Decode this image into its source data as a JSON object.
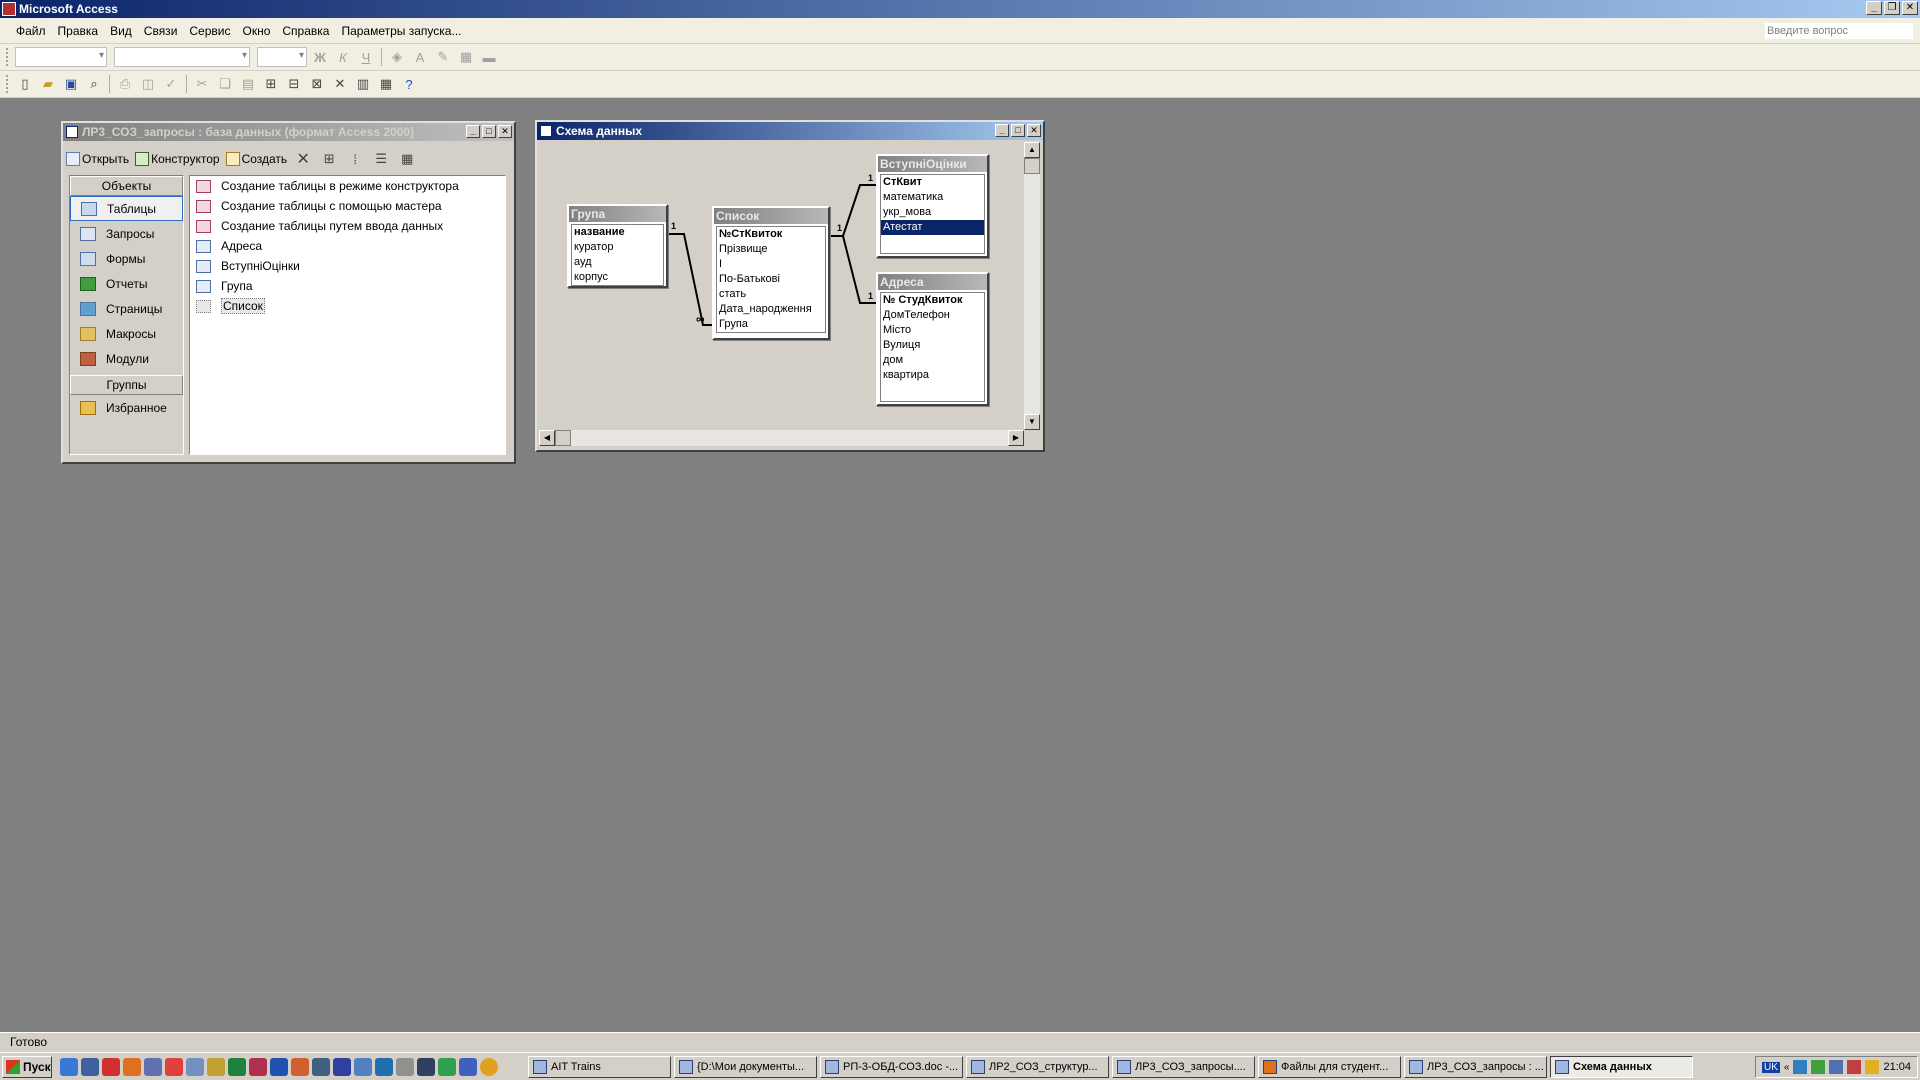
{
  "app": {
    "title": "Microsoft Access"
  },
  "menu": {
    "items": [
      "Файл",
      "Правка",
      "Вид",
      "Связи",
      "Сервис",
      "Окно",
      "Справка",
      "Параметры запуска..."
    ],
    "ask_placeholder": "Введите вопрос"
  },
  "db_window": {
    "title": "ЛР3_СОЗ_запросы : база данных (формат Access 2000)",
    "toolbar": {
      "open": "Открыть",
      "design": "Конструктор",
      "create": "Создать"
    },
    "objects_header": "Объекты",
    "objects": [
      "Таблицы",
      "Запросы",
      "Формы",
      "Отчеты",
      "Страницы",
      "Макросы",
      "Модули"
    ],
    "groups_header": "Группы",
    "groups": [
      "Избранное"
    ],
    "list": [
      "Создание таблицы в режиме конструктора",
      "Создание таблицы с помощью мастера",
      "Создание таблицы путем ввода данных",
      "Адреса",
      "ВступніОцінки",
      "Група",
      "Список"
    ]
  },
  "schema_window": {
    "title": "Схема данных",
    "tables": [
      {
        "name": "Група",
        "fields": [
          "название",
          "куратор",
          "ауд",
          "корпус"
        ]
      },
      {
        "name": "Список",
        "fields": [
          "№СтКвиток",
          "Прізвище",
          "І",
          "По-Батькові",
          "стать",
          "Дата_народження",
          "Група"
        ]
      },
      {
        "name": "ВступніОцінки",
        "fields": [
          "СтКвит",
          "математика",
          "укр_мова",
          "Атестат"
        ]
      },
      {
        "name": "Адреса",
        "fields": [
          "№ СтудКвиток",
          "ДомТелефон",
          "Місто",
          "Вулиця",
          "дом",
          "квартира"
        ]
      }
    ],
    "rel_labels": {
      "one": "1",
      "many": "∞"
    }
  },
  "status": {
    "text": "Готово"
  },
  "taskbar": {
    "start": "Пуск",
    "buttons": [
      "AIT Trains",
      "{D:\\Мои документы...",
      "РП-3-ОБД-СОЗ.doc -...",
      "ЛР2_СОЗ_структур...",
      "ЛР3_СОЗ_запросы....",
      "Файлы для студент...",
      "ЛР3_СОЗ_запросы : ...",
      "Схема данных"
    ],
    "lang": "UK",
    "clock": "21:04"
  },
  "colors": {
    "titlebar": "#0a246a",
    "selection": "#0a246a",
    "workspace": "#808080",
    "chrome": "#d4d0c8"
  }
}
